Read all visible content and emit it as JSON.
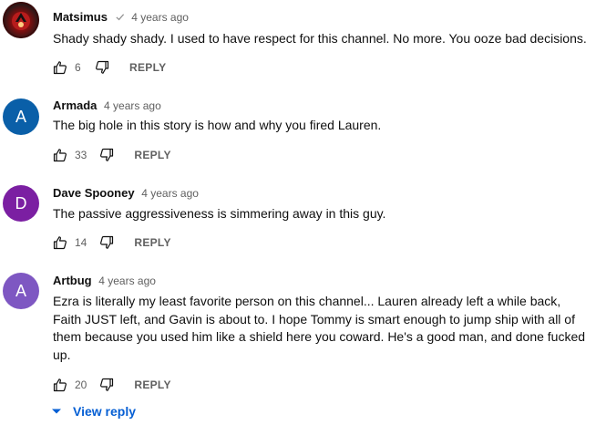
{
  "comments": [
    {
      "author": "Matsimus",
      "verified": true,
      "time": "4 years ago",
      "text": "Shady shady shady. I used to have respect for this channel. No more. You ooze bad decisions.",
      "likes": "6",
      "reply_label": "REPLY",
      "avatar": {
        "type": "image",
        "icon": "channel-logo-icon"
      }
    },
    {
      "author": "Armada",
      "verified": false,
      "time": "4 years ago",
      "text": "The big hole in this story is how and why you fired Lauren.",
      "likes": "33",
      "reply_label": "REPLY",
      "avatar": {
        "type": "letter",
        "letter": "A",
        "color": "#0a5fa8"
      }
    },
    {
      "author": "Dave Spooney",
      "verified": false,
      "time": "4 years ago",
      "text": "The passive aggressiveness is simmering away in this guy.",
      "likes": "14",
      "reply_label": "REPLY",
      "avatar": {
        "type": "letter",
        "letter": "D",
        "color": "#7b1fa2"
      }
    },
    {
      "author": "Artbug",
      "verified": false,
      "time": "4 years ago",
      "text": "Ezra is literally my least favorite person on this channel... Lauren already left a while back, Faith JUST left, and Gavin is about to. I hope Tommy is smart enough to jump ship with all of them because you used him like a shield here you coward. He's a good man, and done fucked up.",
      "likes": "20",
      "reply_label": "REPLY",
      "avatar": {
        "type": "letter",
        "letter": "A",
        "color": "#7e57c2"
      }
    }
  ],
  "view_reply_label": "View reply",
  "colors": {
    "link": "#065fd4",
    "meta": "#606060",
    "text": "#0f0f0f"
  }
}
